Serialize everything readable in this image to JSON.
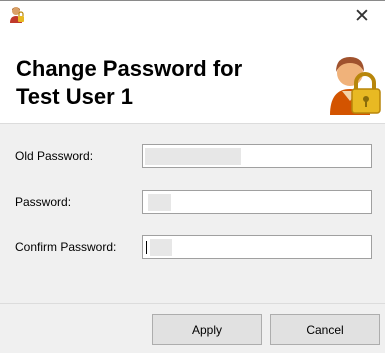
{
  "window": {
    "close_glyph": "✕",
    "icons": {
      "app": "user-icon",
      "header": "user-lock-icon",
      "close": "close-icon"
    }
  },
  "header": {
    "title_line1": "Change Password for",
    "title_line2": "Test User 1"
  },
  "form": {
    "old_password_label": "Old Password:",
    "password_label": "Password:",
    "confirm_password_label": "Confirm Password:"
  },
  "buttons": {
    "apply_label": "Apply",
    "cancel_label": "Cancel"
  },
  "colors": {
    "content_background": "#f0f0f0",
    "button_background": "#e1e1e1",
    "lock_gold": "#e8b923"
  }
}
